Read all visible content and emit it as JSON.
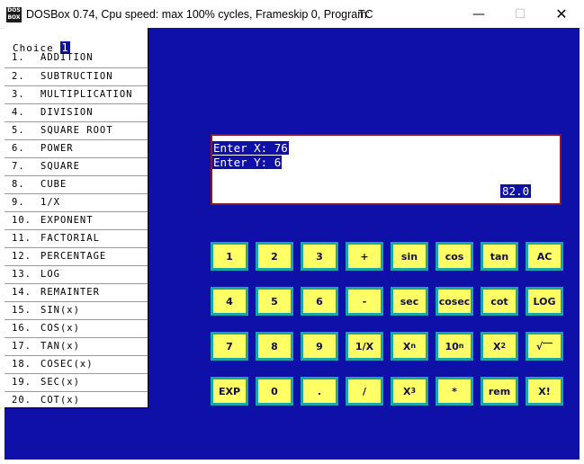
{
  "window": {
    "title": "DOSBox 0.74, Cpu speed: max 100% cycles, Frameskip  0, Program:",
    "program": "TC",
    "icon": "DOS BOX",
    "controls": {
      "minimize": "—",
      "maximize": "☐",
      "close": "✕"
    }
  },
  "menu": {
    "choice_label": "Choice",
    "choice_value": "1",
    "items": [
      {
        "num": "1.",
        "label": "ADDITION"
      },
      {
        "num": "2.",
        "label": "SUBTRUCTION"
      },
      {
        "num": "3.",
        "label": "MULTIPLICATION"
      },
      {
        "num": "4.",
        "label": "DIVISION"
      },
      {
        "num": "5.",
        "label": "SQUARE ROOT"
      },
      {
        "num": "6.",
        "label": "POWER"
      },
      {
        "num": "7.",
        "label": "SQUARE"
      },
      {
        "num": "8.",
        "label": "CUBE"
      },
      {
        "num": "9.",
        "label": "1/X"
      },
      {
        "num": "10.",
        "label": "EXPONENT"
      },
      {
        "num": "11.",
        "label": "FACTORIAL"
      },
      {
        "num": "12.",
        "label": "PERCENTAGE"
      },
      {
        "num": "13.",
        "label": "LOG"
      },
      {
        "num": "14.",
        "label": "REMAINTER"
      },
      {
        "num": "15.",
        "label": "SIN(x)"
      },
      {
        "num": "16.",
        "label": "COS(x)"
      },
      {
        "num": "17.",
        "label": "TAN(x)"
      },
      {
        "num": "18.",
        "label": "COSEC(x)"
      },
      {
        "num": "19.",
        "label": "SEC(x)"
      },
      {
        "num": "20.",
        "label": "COT(x)"
      }
    ]
  },
  "display": {
    "line_x": "Enter X: 76",
    "line_y": "Enter Y: 6",
    "result": "82.0"
  },
  "keypad": {
    "rows": [
      [
        {
          "label": "1"
        },
        {
          "label": "2"
        },
        {
          "label": "3"
        },
        {
          "label": "+"
        },
        {
          "label": "sin"
        },
        {
          "label": "cos"
        },
        {
          "label": "tan"
        },
        {
          "label": "AC"
        }
      ],
      [
        {
          "label": "4"
        },
        {
          "label": "5"
        },
        {
          "label": "6"
        },
        {
          "label": "-"
        },
        {
          "label": "sec"
        },
        {
          "label": "cosec"
        },
        {
          "label": "cot"
        },
        {
          "label": "LOG"
        }
      ],
      [
        {
          "label": "7"
        },
        {
          "label": "8"
        },
        {
          "label": "9"
        },
        {
          "label": "1/X"
        },
        {
          "label": "X",
          "sup": "n"
        },
        {
          "label": "10",
          "sup": "n"
        },
        {
          "label": "X",
          "sup": "2"
        },
        {
          "label": "√‾‾"
        }
      ],
      [
        {
          "label": "EXP"
        },
        {
          "label": "0"
        },
        {
          "label": "."
        },
        {
          "label": "/"
        },
        {
          "label": "X",
          "sup": "3"
        },
        {
          "label": "*"
        },
        {
          "label": "rem"
        },
        {
          "label": "X!"
        }
      ]
    ]
  },
  "colors": {
    "screen_bg": "#0f10a8",
    "key_bg": "#ffff66",
    "key_border": "#19a6a6",
    "display_border": "#8b1a1a"
  }
}
